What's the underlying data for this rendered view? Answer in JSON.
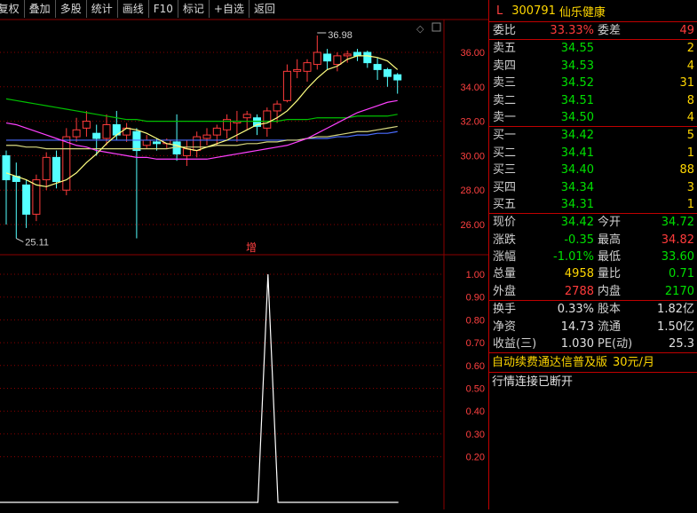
{
  "toolbar": [
    "复权",
    "叠加",
    "多股",
    "统计",
    "画线",
    "F10",
    "标记",
    "+自选",
    "返回"
  ],
  "kline": {
    "price_labels": [
      "36.00",
      "34.00",
      "32.00",
      "30.00",
      "28.00",
      "26.00"
    ],
    "high_annot": "36.98",
    "low_annot": "25.11",
    "indicator_tag": "增",
    "ind_labels": [
      "1.00",
      "0.90",
      "0.80",
      "0.70",
      "0.60",
      "0.50",
      "0.40",
      "0.30",
      "0.20"
    ]
  },
  "chart_data": {
    "type": "candlestick",
    "price_ylim": [
      24.9,
      37.6
    ],
    "candles": [
      {
        "o": 30.0,
        "c": 28.6,
        "h": 30.3,
        "l": 26.0
      },
      {
        "o": 28.8,
        "c": 28.5,
        "h": 29.6,
        "l": 25.2
      },
      {
        "o": 28.3,
        "c": 26.6,
        "h": 28.6,
        "l": 25.8
      },
      {
        "o": 26.6,
        "c": 28.6,
        "h": 28.9,
        "l": 26.2
      },
      {
        "o": 28.6,
        "c": 29.9,
        "h": 30.2,
        "l": 28.0
      },
      {
        "o": 29.9,
        "c": 28.5,
        "h": 30.3,
        "l": 28.1
      },
      {
        "o": 28.0,
        "c": 31.1,
        "h": 31.6,
        "l": 27.7
      },
      {
        "o": 31.1,
        "c": 31.5,
        "h": 32.2,
        "l": 30.8
      },
      {
        "o": 31.6,
        "c": 32.0,
        "h": 32.6,
        "l": 31.1
      },
      {
        "o": 31.3,
        "c": 31.0,
        "h": 31.8,
        "l": 30.0
      },
      {
        "o": 31.0,
        "c": 31.8,
        "h": 32.4,
        "l": 30.6
      },
      {
        "o": 31.8,
        "c": 31.2,
        "h": 32.6,
        "l": 30.9
      },
      {
        "o": 31.2,
        "c": 31.6,
        "h": 31.9,
        "l": 30.8
      },
      {
        "o": 31.4,
        "c": 30.3,
        "h": 31.6,
        "l": 25.2
      },
      {
        "o": 30.6,
        "c": 30.9,
        "h": 31.2,
        "l": 30.4
      },
      {
        "o": 30.8,
        "c": 30.7,
        "h": 31.0,
        "l": 30.3
      },
      {
        "o": 30.7,
        "c": 30.9,
        "h": 31.0,
        "l": 30.4
      },
      {
        "o": 30.8,
        "c": 30.1,
        "h": 32.4,
        "l": 29.7
      },
      {
        "o": 30.0,
        "c": 30.4,
        "h": 30.9,
        "l": 29.4
      },
      {
        "o": 30.3,
        "c": 31.1,
        "h": 31.4,
        "l": 29.9
      },
      {
        "o": 31.0,
        "c": 31.2,
        "h": 31.6,
        "l": 30.6
      },
      {
        "o": 31.2,
        "c": 31.6,
        "h": 31.8,
        "l": 30.6
      },
      {
        "o": 31.5,
        "c": 32.1,
        "h": 32.4,
        "l": 31.0
      },
      {
        "o": 31.9,
        "c": 32.0,
        "h": 32.6,
        "l": 30.8
      },
      {
        "o": 32.2,
        "c": 32.4,
        "h": 32.6,
        "l": 31.5
      },
      {
        "o": 32.2,
        "c": 31.7,
        "h": 32.4,
        "l": 31.2
      },
      {
        "o": 31.6,
        "c": 32.6,
        "h": 32.8,
        "l": 31.1
      },
      {
        "o": 32.6,
        "c": 33.0,
        "h": 33.2,
        "l": 31.9
      },
      {
        "o": 33.2,
        "c": 34.9,
        "h": 35.3,
        "l": 33.1
      },
      {
        "o": 34.9,
        "c": 35.0,
        "h": 35.6,
        "l": 34.5
      },
      {
        "o": 34.9,
        "c": 35.4,
        "h": 35.6,
        "l": 34.3
      },
      {
        "o": 35.3,
        "c": 36.0,
        "h": 36.98,
        "l": 35.0
      },
      {
        "o": 35.9,
        "c": 35.5,
        "h": 36.2,
        "l": 35.0
      },
      {
        "o": 35.3,
        "c": 35.8,
        "h": 36.0,
        "l": 34.9
      },
      {
        "o": 35.8,
        "c": 35.9,
        "h": 36.1,
        "l": 35.4
      },
      {
        "o": 36.0,
        "c": 35.8,
        "h": 36.2,
        "l": 35.5
      },
      {
        "o": 36.0,
        "c": 35.4,
        "h": 36.1,
        "l": 35.1
      },
      {
        "o": 35.3,
        "c": 35.0,
        "h": 35.7,
        "l": 34.4
      },
      {
        "o": 35.0,
        "c": 34.6,
        "h": 35.1,
        "l": 34.0
      },
      {
        "o": 34.7,
        "c": 34.4,
        "h": 34.8,
        "l": 33.6
      }
    ],
    "ma5": [
      29.0,
      28.8,
      28.6,
      28.3,
      28.2,
      28.4,
      28.6,
      29.0,
      29.6,
      30.1,
      30.7,
      31.2,
      31.6,
      31.5,
      31.3,
      31.0,
      30.7,
      30.6,
      30.4,
      30.3,
      30.5,
      30.7,
      30.9,
      31.2,
      31.5,
      31.8,
      31.9,
      32.2,
      32.6,
      33.2,
      33.9,
      34.5,
      35.0,
      35.2,
      35.6,
      35.8,
      35.8,
      35.7,
      35.5,
      35.0
    ],
    "ma_green": [
      33.3,
      33.2,
      33.1,
      33.0,
      32.9,
      32.8,
      32.7,
      32.6,
      32.5,
      32.4,
      32.3,
      32.2,
      32.1,
      32.1,
      32.0,
      32.0,
      32.0,
      32.0,
      32.0,
      32.0,
      32.0,
      32.0,
      32.0,
      32.0,
      32.0,
      32.0,
      32.0,
      32.0,
      32.1,
      32.1,
      32.1,
      32.2,
      32.2,
      32.2,
      32.2,
      32.3,
      32.3,
      32.3,
      32.3,
      32.4
    ],
    "ma_magenta": [
      31.9,
      31.8,
      31.6,
      31.4,
      31.2,
      31.0,
      30.8,
      30.6,
      30.5,
      30.3,
      30.2,
      30.1,
      30.0,
      29.9,
      29.9,
      29.8,
      29.8,
      29.8,
      29.8,
      29.8,
      29.8,
      29.9,
      30.0,
      30.1,
      30.2,
      30.3,
      30.4,
      30.5,
      30.6,
      30.8,
      31.0,
      31.3,
      31.6,
      31.9,
      32.2,
      32.5,
      32.7,
      32.9,
      33.1,
      33.2
    ],
    "ma_blue": [
      30.9,
      30.9,
      30.9,
      30.9,
      30.9,
      30.9,
      30.9,
      30.9,
      30.9,
      30.9,
      30.9,
      30.9,
      30.9,
      30.9,
      30.9,
      30.9,
      30.9,
      30.9,
      30.9,
      30.9,
      30.9,
      30.9,
      30.9,
      30.9,
      30.9,
      30.9,
      30.9,
      30.9,
      30.9,
      30.9,
      31.0,
      31.0,
      31.0,
      31.1,
      31.1,
      31.2,
      31.2,
      31.3,
      31.3,
      31.4
    ],
    "ma_slow_yellow": [
      30.6,
      30.6,
      30.5,
      30.5,
      30.4,
      30.4,
      30.4,
      30.4,
      30.4,
      30.4,
      30.4,
      30.4,
      30.4,
      30.4,
      30.4,
      30.4,
      30.4,
      30.5,
      30.5,
      30.5,
      30.5,
      30.6,
      30.6,
      30.6,
      30.7,
      30.7,
      30.8,
      30.8,
      30.9,
      30.9,
      31.0,
      31.1,
      31.1,
      31.2,
      31.3,
      31.4,
      31.4,
      31.5,
      31.6,
      31.7
    ],
    "ind_ylim": [
      0,
      1.1
    ],
    "indicator": [
      0,
      0,
      0,
      0,
      0,
      0,
      0,
      0,
      0,
      0,
      0,
      0,
      0,
      0,
      0,
      0,
      0,
      0,
      0,
      0,
      0,
      0,
      0,
      0,
      0,
      0,
      1.0,
      0,
      0,
      0,
      0,
      0,
      0,
      0,
      0,
      0,
      0,
      0,
      0,
      0
    ],
    "colors": {
      "up": "#ff3b3b",
      "down": "#54ffff",
      "ma5": "#ffff80",
      "green": "#00c000",
      "magenta": "#ff40ff",
      "blue": "#4a6cff",
      "grid": "#8b0000"
    }
  },
  "quote": {
    "header": {
      "market": "L",
      "code": "300791",
      "name": "仙乐健康"
    },
    "weibi": {
      "label": "委比",
      "value": "33.33%",
      "label2": "委差",
      "value2": "49"
    },
    "asks": [
      {
        "label": "卖五",
        "price": "34.55",
        "vol": "2"
      },
      {
        "label": "卖四",
        "price": "34.53",
        "vol": "4"
      },
      {
        "label": "卖三",
        "price": "34.52",
        "vol": "31"
      },
      {
        "label": "卖二",
        "price": "34.51",
        "vol": "8"
      },
      {
        "label": "卖一",
        "price": "34.50",
        "vol": "4"
      }
    ],
    "bids": [
      {
        "label": "买一",
        "price": "34.42",
        "vol": "5"
      },
      {
        "label": "买二",
        "price": "34.41",
        "vol": "1"
      },
      {
        "label": "买三",
        "price": "34.40",
        "vol": "88"
      },
      {
        "label": "买四",
        "price": "34.34",
        "vol": "3"
      },
      {
        "label": "买五",
        "price": "34.31",
        "vol": "1"
      }
    ],
    "stats1": [
      {
        "l1": "现价",
        "v1": "34.42",
        "c1": "green",
        "l2": "今开",
        "v2": "34.72",
        "c2": "green"
      },
      {
        "l1": "涨跌",
        "v1": "-0.35",
        "c1": "green",
        "l2": "最高",
        "v2": "34.82",
        "c2": "red"
      },
      {
        "l1": "涨幅",
        "v1": "-1.01%",
        "c1": "green",
        "l2": "最低",
        "v2": "33.60",
        "c2": "green"
      },
      {
        "l1": "总量",
        "v1": "4958",
        "c1": "yellow",
        "l2": "量比",
        "v2": "0.71",
        "c2": "green"
      },
      {
        "l1": "外盘",
        "v1": "2788",
        "c1": "red",
        "l2": "内盘",
        "v2": "2170",
        "c2": "green"
      }
    ],
    "stats2": [
      {
        "l1": "换手",
        "v1": "0.33%",
        "c1": "white",
        "l2": "股本",
        "v2": "1.82亿",
        "c2": "white"
      },
      {
        "l1": "净资",
        "v1": "14.73",
        "c1": "white",
        "l2": "流通",
        "v2": "1.50亿",
        "c2": "white"
      },
      {
        "l1": "收益(三)",
        "v1": "1.030",
        "c1": "white",
        "l2": "PE(动)",
        "v2": "25.3",
        "c2": "white"
      }
    ],
    "promo": {
      "text": "自动续费通达信普及版",
      "price": "30元/月"
    },
    "connection": "行情连接已断开"
  }
}
